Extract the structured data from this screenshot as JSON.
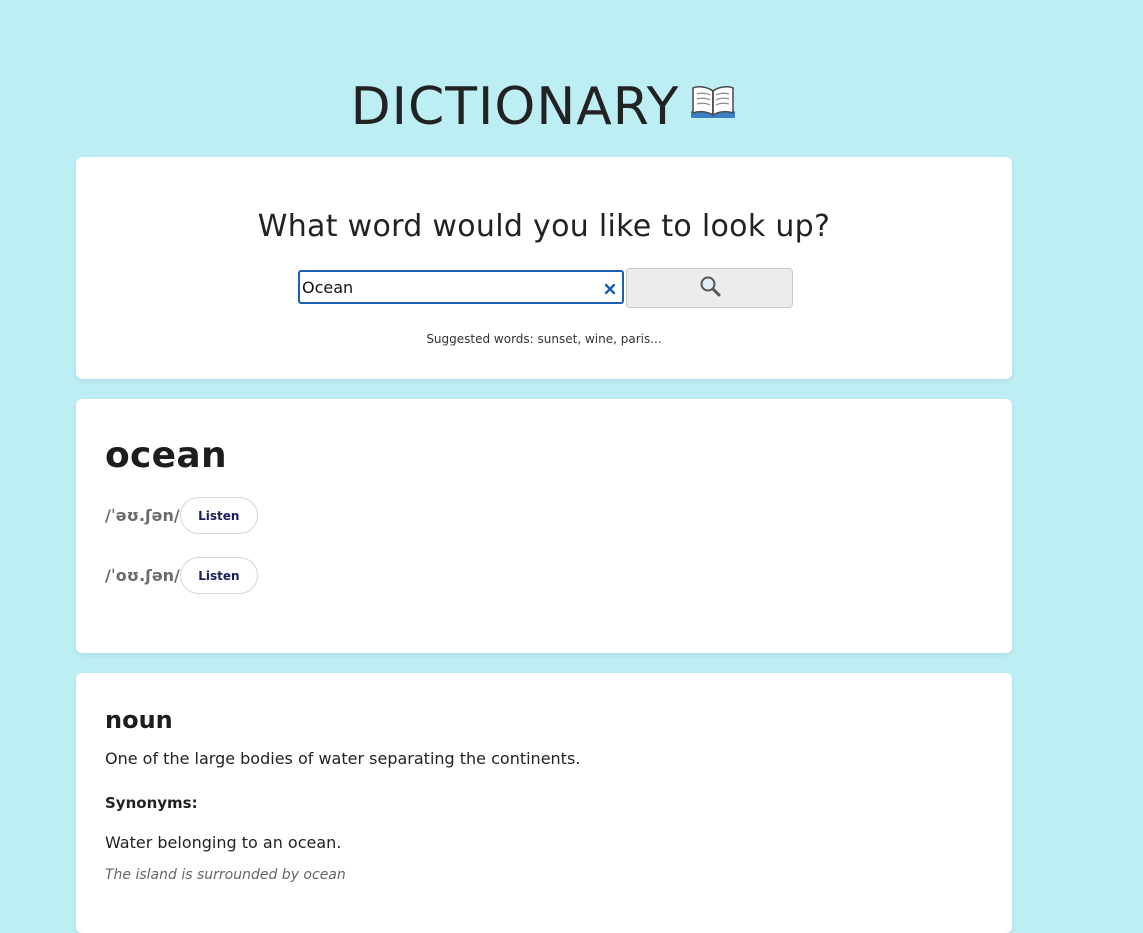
{
  "header": {
    "title": "DICTIONARY",
    "icon": "open-book-icon"
  },
  "search": {
    "question": "What word would you like to look up?",
    "value": "Ocean",
    "clear_icon": "close-icon",
    "button_icon": "search-icon",
    "suggested": "Suggested words: sunset, wine, paris..."
  },
  "result": {
    "word": "ocean",
    "phonetics": [
      {
        "text": "/ˈəʊ.ʃən/",
        "listen_label": "Listen"
      },
      {
        "text": "/ˈoʊ.ʃən/",
        "listen_label": "Listen"
      }
    ]
  },
  "meaning": {
    "part_of_speech": "noun",
    "definition": "One of the large bodies of water separating the continents.",
    "synonyms_label": "Synonyms:",
    "definition2": "Water belonging to an ocean.",
    "example": "The island is surrounded by ocean"
  },
  "colors": {
    "background": "#bdeef4",
    "card": "#ffffff",
    "input_border": "#1a5fb4",
    "listen_text": "#1b1f5e"
  }
}
